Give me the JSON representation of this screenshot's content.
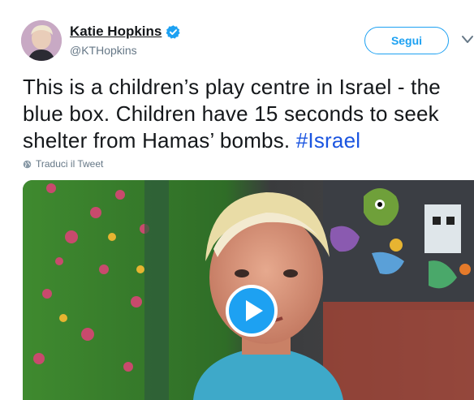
{
  "author": {
    "name": "Katie Hopkins",
    "handle": "@KTHopkins",
    "verified_icon": "verified-badge-icon"
  },
  "actions": {
    "follow_label": "Segui",
    "menu_icon": "chevron-down-icon"
  },
  "tweet": {
    "text": "This is a children’s play centre in Israel - the blue box. Children have 15 seconds to seek shelter from Hamas’ bombs. ",
    "hashtag": "#Israel"
  },
  "translate": {
    "label": "Traduci il Tweet",
    "icon": "globe-icon"
  },
  "media": {
    "type": "video",
    "play_icon": "play-icon"
  },
  "colors": {
    "accent": "#1da1f2",
    "hashtag": "#1b55e0",
    "muted": "#657786",
    "text": "#14171a"
  }
}
